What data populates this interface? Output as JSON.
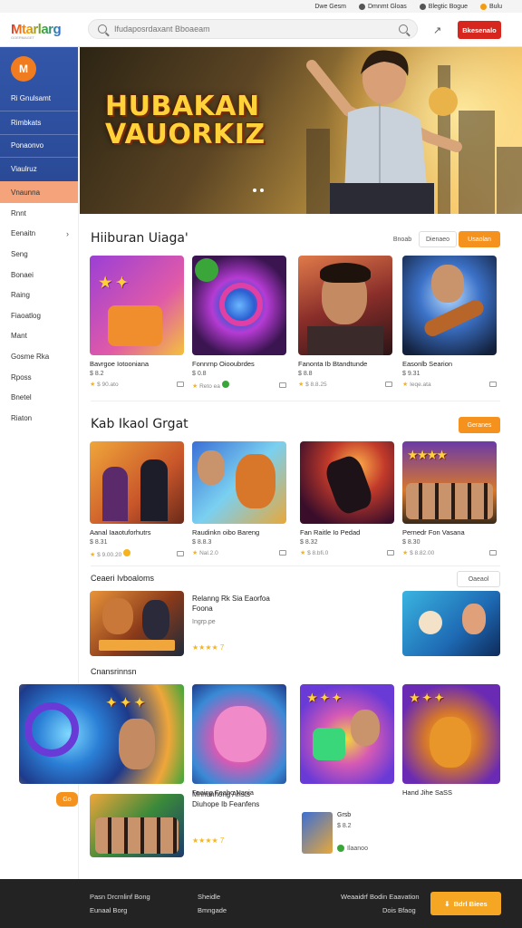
{
  "topbar": {
    "items": [
      "Dwe Gesm",
      "Dmnmt Gloas",
      "Blegtic Bogue",
      "Bulu"
    ]
  },
  "header": {
    "logo": "Mtarlarg",
    "logo_sub": "GOERMAGET",
    "search_placeholder": "Ifudaposrdaxant Bboaeam",
    "signin_label": "Bkesenalo"
  },
  "sidebar": {
    "avatar": "M",
    "blue_items": [
      "Ri Gnulsamt",
      "Rimbkats",
      "Ponaonvo",
      "Viaulruz"
    ],
    "active_item": "Vnaunna",
    "items": [
      "Rnnt",
      "Eenaitn",
      "Seng",
      "Bonaei",
      "Raing",
      "Fiaoatlog",
      "Mant",
      "Gosme Rka",
      "Rposs",
      "Bnetel",
      "Riaton"
    ]
  },
  "hero": {
    "title_line1": "HUBAKAN",
    "title_line2": "VAUORKIZ"
  },
  "section1": {
    "title": "Hiiburan Uiaga'",
    "ghost1": "Bnoab",
    "ghost2": "Dienaeo",
    "button": "Usaolan",
    "cards": [
      {
        "title": "Bavrgoe Iotooniana",
        "meta": "$ 8.2",
        "stat": "$ 90.ato",
        "art": "candy"
      },
      {
        "title": "Fonnrnp Oiooubrdes",
        "meta": "$ 0.8",
        "stat": "Reto ea",
        "art": "portal"
      },
      {
        "title": "Fanonta Ib Btandtunde",
        "meta": "$ 8.8",
        "stat": "$ 8.8.25",
        "art": "portrait"
      },
      {
        "title": "Easonlb Searion",
        "meta": "$ 9.31",
        "stat": "Ieqe.ata",
        "art": "guitar"
      }
    ]
  },
  "section2": {
    "title": "Kab Ikaol Grgat",
    "button": "Geranes",
    "cards": [
      {
        "title": "Aanal Iaaotuforhutrs",
        "meta": "$ 8.31",
        "stat": "$ 9.00.20",
        "art": "duo"
      },
      {
        "title": "Raudinkn oibo Bareng",
        "meta": "$ 8.8.3",
        "stat": "Nal.2.0",
        "art": "party"
      },
      {
        "title": "Fan Raitle Io Pedad",
        "meta": "$ 8.32",
        "stat": "$ 8.bfi.0",
        "art": "jump"
      },
      {
        "title": "Pernedr Fon Vasana",
        "meta": "$ 8.30",
        "stat": "$ 8.82.00",
        "art": "crowd"
      }
    ]
  },
  "section3": {
    "title": "Ceaeri Ivboaloms",
    "ghost": "Oaeaol",
    "feature_title": "Relanng Rk Sia Eaorfoa",
    "feature_sub": "Foona",
    "feature_meta": "Ingrp.pe",
    "rating": "★★★★ 7"
  },
  "section4": {
    "title": "Cnansrinnsn",
    "cards": [
      {
        "title": "Faaing Feabo Nania",
        "art": "pink"
      },
      {
        "title": "Hand Jihe SaSS",
        "art": "bear"
      }
    ],
    "promo_title": "Mnnunhong Arlsts",
    "promo_sub": "Diuhope Ib Feanfens",
    "rating": "★★★★ 7",
    "small_title": "Grsb",
    "small_meta": "$ 8.2",
    "small_stat": "Ilaanoo",
    "chat": "Go"
  },
  "footer": {
    "col1": [
      "Pasn Drcrnlinf Bong",
      "Eunaal Borg"
    ],
    "col2": [
      "Sheidle",
      "Bmngade"
    ],
    "col3": [
      "Weaaidrf Bodin Eaavation",
      "Dois Bfaog"
    ],
    "button": "Bdrl Biees"
  }
}
